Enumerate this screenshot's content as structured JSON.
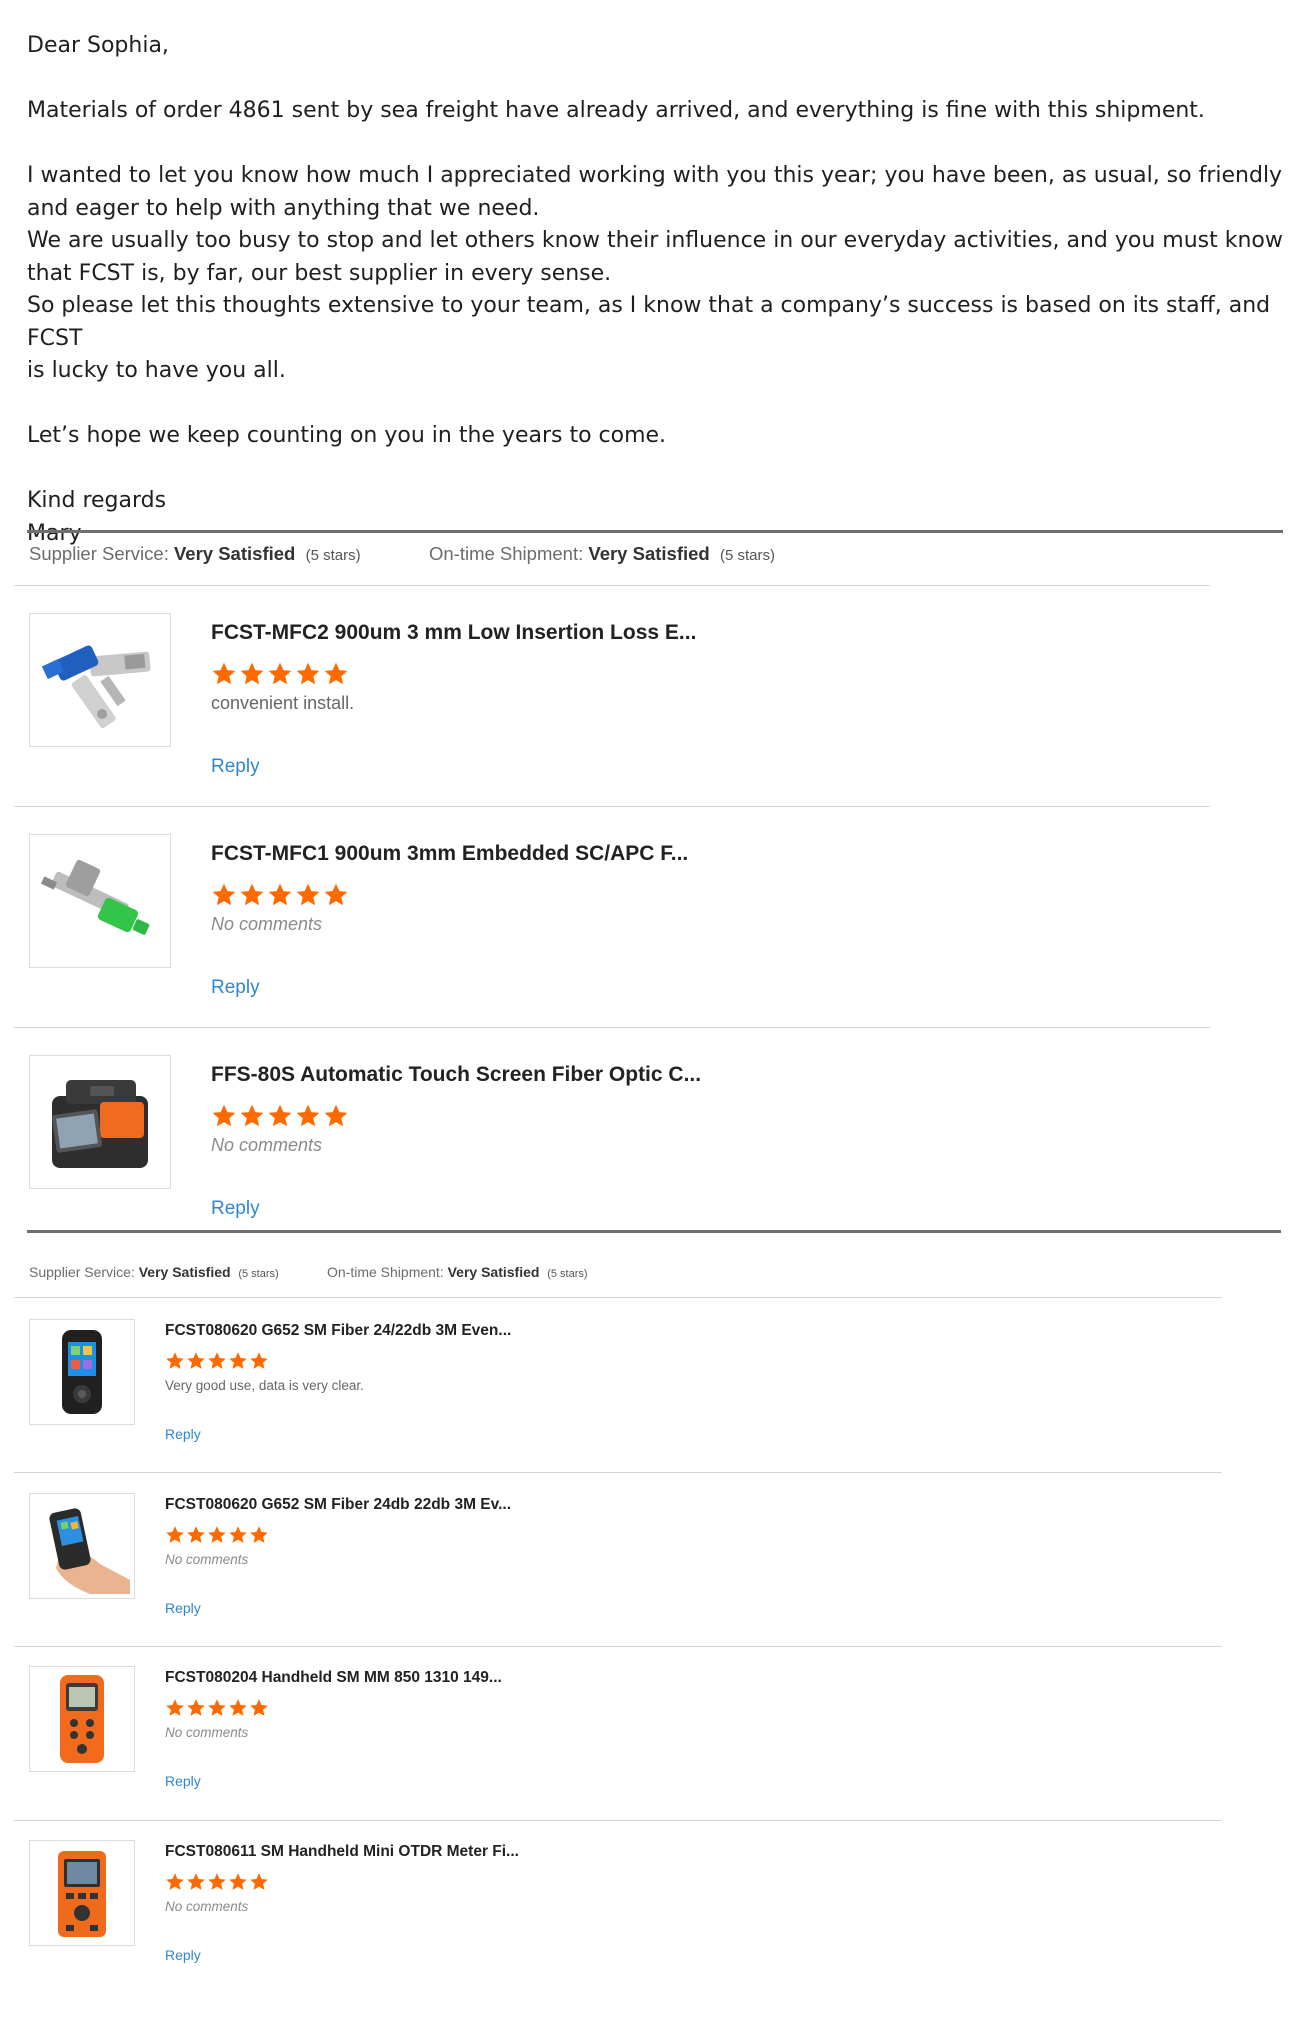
{
  "letter": {
    "greeting": "Dear Sophia,",
    "p1": "Materials of order 4861 sent by sea freight have already arrived, and everything is fine with this shipment.",
    "p2_l1": "I wanted to let you know how much I appreciated working with you this year; you have been, as usual, so friendly",
    "p2_l2": "and eager to help with anything that we need.",
    "p2_l3": "We are usually too busy to stop and let others know their influence in our everyday activities, and you must know",
    "p2_l4": "that FCST is, by far, our best supplier in every sense.",
    "p2_l5": "So please let this thoughts extensive to your team, as I know that a company’s success is based on its staff, and FCST",
    "p2_l6": "is lucky to have you all.",
    "p3": "Let’s hope we keep counting on you in the years to come.",
    "closing": "Kind regards",
    "signature": "Mary"
  },
  "section1": {
    "supplier_label": "Supplier Service:",
    "supplier_value": "Very Satisfied",
    "supplier_stars": "(5 stars)",
    "shipment_label": "On-time Shipment:",
    "shipment_value": "Very Satisfied",
    "shipment_stars": "(5 stars)",
    "reviews": [
      {
        "title": "FCST-MFC2 900um 3 mm Low Insertion Loss E...",
        "rating": 5,
        "comment": "convenient install.",
        "reply": "Reply",
        "icon": "blue-fiber-connector"
      },
      {
        "title": "FCST-MFC1 900um 3mm Embedded SC/APC F...",
        "rating": 5,
        "comment": "No comments",
        "reply": "Reply",
        "icon": "green-fiber-connector"
      },
      {
        "title": "FFS-80S Automatic Touch Screen Fiber Optic C...",
        "rating": 5,
        "comment": "No comments",
        "reply": "Reply",
        "icon": "fusion-splicer"
      }
    ]
  },
  "section2": {
    "supplier_label": "Supplier Service:",
    "supplier_value": "Very Satisfied",
    "supplier_stars": "(5 stars)",
    "shipment_label": "On-time Shipment:",
    "shipment_value": "Very Satisfied",
    "shipment_stars": "(5 stars)",
    "reviews": [
      {
        "title": "FCST080620 G652 SM Fiber 24/22db 3M Even...",
        "rating": 5,
        "comment": "Very good use, data is very clear.",
        "reply": "Reply",
        "icon": "black-handheld-meter"
      },
      {
        "title": "FCST080620 G652 SM Fiber 24db 22db 3M Ev...",
        "rating": 5,
        "comment": "No comments",
        "reply": "Reply",
        "icon": "hand-held-meter"
      },
      {
        "title": "FCST080204 Handheld SM MM 850 1310 149...",
        "rating": 5,
        "comment": "No comments",
        "reply": "Reply",
        "icon": "orange-power-meter"
      },
      {
        "title": "FCST080611 SM Handheld Mini OTDR Meter Fi...",
        "rating": 5,
        "comment": "No comments",
        "reply": "Reply",
        "icon": "orange-otdr-meter"
      }
    ]
  },
  "colors": {
    "star": "#ff6a00",
    "link": "#2f86d1",
    "rule": "#6f6f6f"
  }
}
